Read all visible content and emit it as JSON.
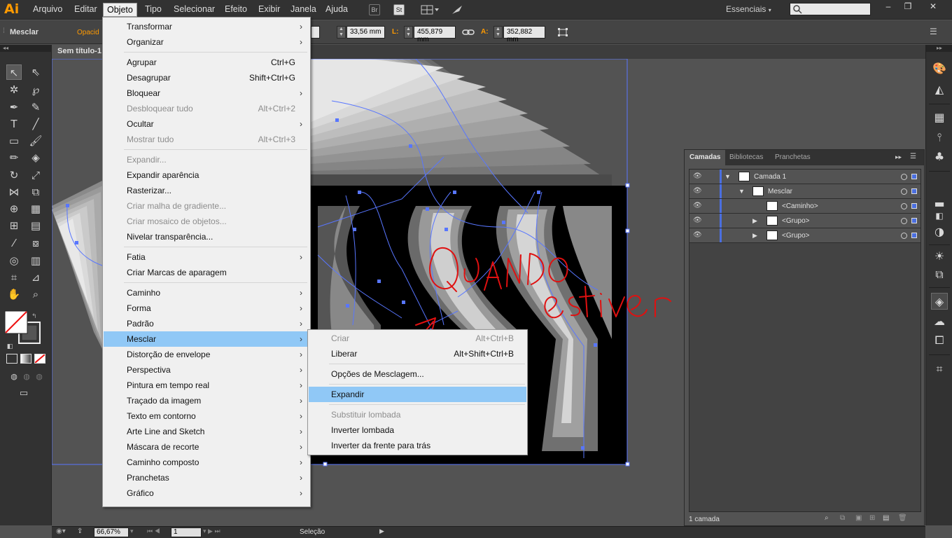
{
  "app": {
    "logo": "Ai",
    "menus": [
      "Arquivo",
      "Editar",
      "Objeto",
      "Tipo",
      "Selecionar",
      "Efeito",
      "Exibir",
      "Janela",
      "Ajuda"
    ],
    "toolbar_icons": [
      "Br",
      "St"
    ],
    "workspace": "Essenciais",
    "window_controls": [
      "–",
      "❐",
      "✕"
    ]
  },
  "controlbar": {
    "selection_label": "Mesclar",
    "opacity_label": "Opacid",
    "height_value": "33,56 mm",
    "width_label": "L:",
    "width_value": "455,879 mm",
    "alt_label": "A:",
    "alt_value": "352,882 mm"
  },
  "document": {
    "tab_title": "Sem título-1"
  },
  "objeto_menu": {
    "items": [
      {
        "label": "Transformar",
        "shortcut": "",
        "submenu": true,
        "disabled": false
      },
      {
        "label": "Organizar",
        "shortcut": "",
        "submenu": true,
        "disabled": false
      },
      {
        "label": "Agrupar",
        "shortcut": "Ctrl+G",
        "submenu": false,
        "disabled": false
      },
      {
        "label": "Desagrupar",
        "shortcut": "Shift+Ctrl+G",
        "submenu": false,
        "disabled": false
      },
      {
        "label": "Bloquear",
        "shortcut": "",
        "submenu": true,
        "disabled": false
      },
      {
        "label": "Desbloquear tudo",
        "shortcut": "Alt+Ctrl+2",
        "submenu": false,
        "disabled": true
      },
      {
        "label": "Ocultar",
        "shortcut": "",
        "submenu": true,
        "disabled": false
      },
      {
        "label": "Mostrar tudo",
        "shortcut": "Alt+Ctrl+3",
        "submenu": false,
        "disabled": true
      },
      {
        "label": "Expandir...",
        "shortcut": "",
        "submenu": false,
        "disabled": true
      },
      {
        "label": "Expandir aparência",
        "shortcut": "",
        "submenu": false,
        "disabled": false
      },
      {
        "label": "Rasterizar...",
        "shortcut": "",
        "submenu": false,
        "disabled": false
      },
      {
        "label": "Criar malha de gradiente...",
        "shortcut": "",
        "submenu": false,
        "disabled": true
      },
      {
        "label": "Criar mosaico de objetos...",
        "shortcut": "",
        "submenu": false,
        "disabled": true
      },
      {
        "label": "Nivelar transparência...",
        "shortcut": "",
        "submenu": false,
        "disabled": false
      },
      {
        "label": "Fatia",
        "shortcut": "",
        "submenu": true,
        "disabled": false
      },
      {
        "label": "Criar Marcas de aparagem",
        "shortcut": "",
        "submenu": false,
        "disabled": false
      },
      {
        "label": "Caminho",
        "shortcut": "",
        "submenu": true,
        "disabled": false
      },
      {
        "label": "Forma",
        "shortcut": "",
        "submenu": true,
        "disabled": false
      },
      {
        "label": "Padrão",
        "shortcut": "",
        "submenu": true,
        "disabled": false
      },
      {
        "label": "Mesclar",
        "shortcut": "",
        "submenu": true,
        "disabled": false
      },
      {
        "label": "Distorção de envelope",
        "shortcut": "",
        "submenu": true,
        "disabled": false
      },
      {
        "label": "Perspectiva",
        "shortcut": "",
        "submenu": true,
        "disabled": false
      },
      {
        "label": "Pintura em tempo real",
        "shortcut": "",
        "submenu": true,
        "disabled": false
      },
      {
        "label": "Traçado da imagem",
        "shortcut": "",
        "submenu": true,
        "disabled": false
      },
      {
        "label": "Texto em contorno",
        "shortcut": "",
        "submenu": true,
        "disabled": false
      },
      {
        "label": "Arte Line and Sketch",
        "shortcut": "",
        "submenu": true,
        "disabled": false
      },
      {
        "label": "Máscara de recorte",
        "shortcut": "",
        "submenu": true,
        "disabled": false
      },
      {
        "label": "Caminho composto",
        "shortcut": "",
        "submenu": true,
        "disabled": false
      },
      {
        "label": "Pranchetas",
        "shortcut": "",
        "submenu": true,
        "disabled": false
      },
      {
        "label": "Gráfico",
        "shortcut": "",
        "submenu": true,
        "disabled": false
      }
    ],
    "highlighted": "Mesclar"
  },
  "mesclar_submenu": {
    "items": [
      {
        "label": "Criar",
        "shortcut": "Alt+Ctrl+B",
        "disabled": true
      },
      {
        "label": "Liberar",
        "shortcut": "Alt+Shift+Ctrl+B",
        "disabled": false
      },
      {
        "label": "Opções de Mesclagem...",
        "shortcut": "",
        "disabled": false
      },
      {
        "label": "Expandir",
        "shortcut": "",
        "disabled": false
      },
      {
        "label": "Substituir lombada",
        "shortcut": "",
        "disabled": true
      },
      {
        "label": "Inverter lombada",
        "shortcut": "",
        "disabled": false
      },
      {
        "label": "Inverter da frente para trás",
        "shortcut": "",
        "disabled": false
      }
    ],
    "highlighted": "Expandir"
  },
  "layers_panel": {
    "tabs": [
      "Camadas",
      "Bibliotecas",
      "Pranchetas"
    ],
    "active_tab": "Camadas",
    "rows": [
      {
        "name": "Camada 1",
        "indent": 0,
        "expanded": true
      },
      {
        "name": "Mesclar",
        "indent": 1,
        "expanded": true
      },
      {
        "name": "<Caminho>",
        "indent": 2,
        "expanded": false
      },
      {
        "name": "<Grupo>",
        "indent": 2,
        "expanded": false
      },
      {
        "name": "<Grupo>",
        "indent": 2,
        "expanded": false
      }
    ],
    "footer_count": "1 camada"
  },
  "statusbar": {
    "zoom": "66,67%",
    "artboard": "1",
    "tool": "Seleção"
  },
  "annotation": {
    "handwriting": "QUANDO estiver Bonito",
    "color": "#e01010"
  },
  "colors": {
    "menu_highlight": "#90c8f6",
    "accent_orange": "#ff9a00",
    "layer_blue": "#4b6fe0"
  }
}
